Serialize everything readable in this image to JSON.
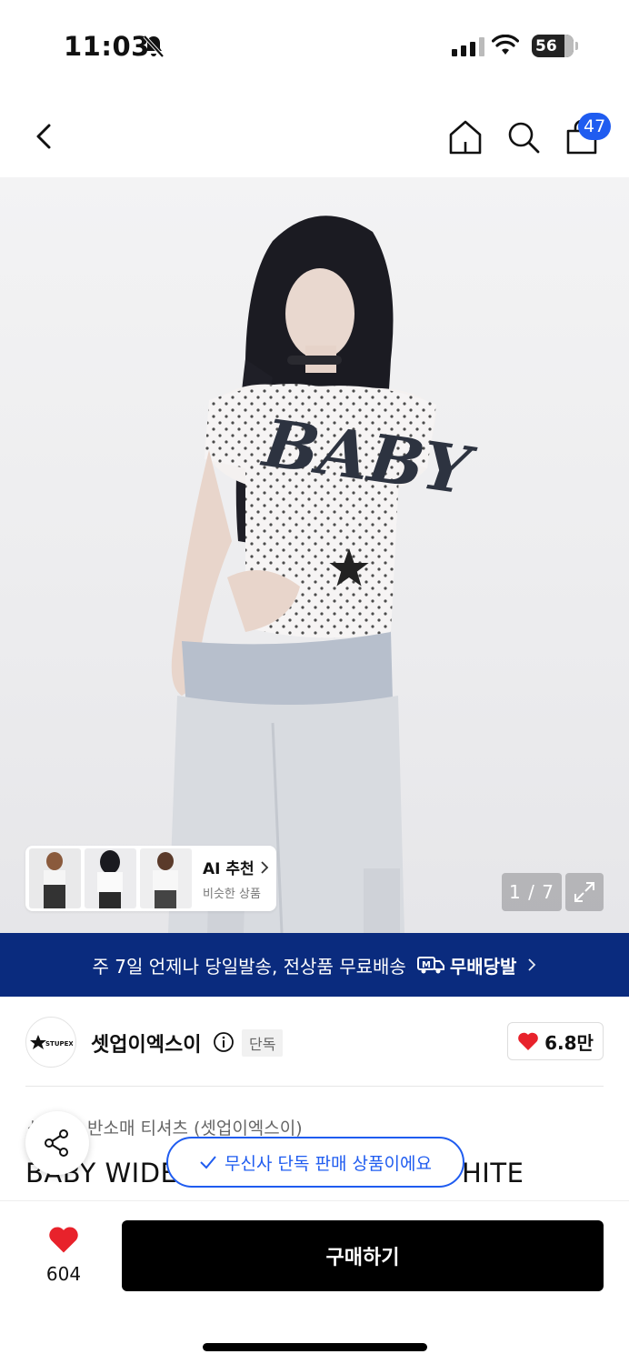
{
  "status_bar": {
    "time": "11:03",
    "battery": "56"
  },
  "nav": {
    "cart_badge": "47"
  },
  "hero": {
    "ai_card": {
      "title": "AI 추천",
      "subtitle": "비슷한 상품"
    },
    "pager": "1 / 7"
  },
  "promo": {
    "text": "주 7일 언제나 당일발송, 전상품 무료배송",
    "logo_text": "무배당발"
  },
  "brand": {
    "logo_text": "STUPEXE",
    "name": "셋업이엑스이",
    "exclusive_label": "단독",
    "likes": "6.8만"
  },
  "product": {
    "category_prefix": "상",
    "category": "반소매 티셔츠 (셋업이엑스이)",
    "title_start": "BABY WIDE",
    "title_end": "HITE"
  },
  "toast": {
    "text": "무신사 단독 판매 상품이에요"
  },
  "bottom": {
    "like_count": "604",
    "buy_label": "구매하기"
  },
  "colors": {
    "accent": "#1f5cf0",
    "promo_bg": "#0a2b7e",
    "heart": "#e8222b"
  }
}
